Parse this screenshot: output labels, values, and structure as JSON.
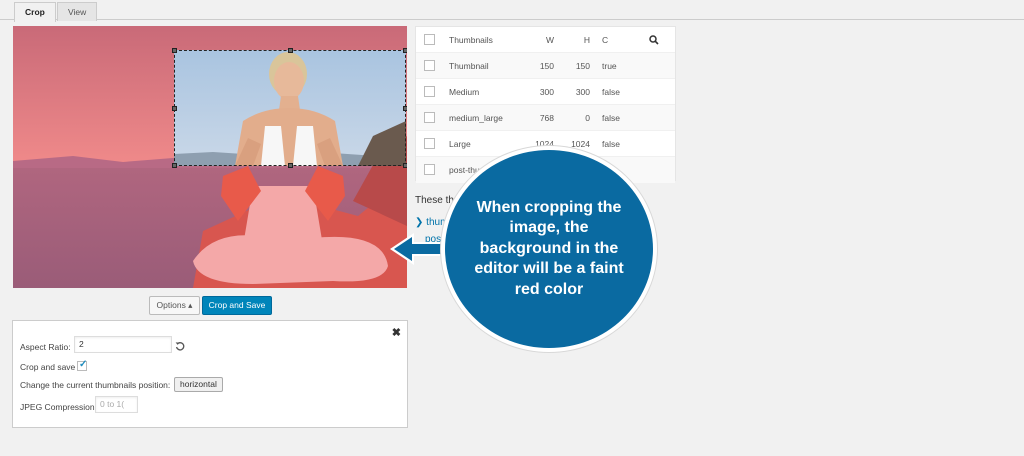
{
  "tabs": [
    {
      "label": "Crop",
      "active": true
    },
    {
      "label": "View",
      "active": false
    }
  ],
  "toolbar": {
    "options_label": "Options ▴",
    "crop_save_label": "Crop and Save"
  },
  "options_panel": {
    "close_icon": "✖",
    "aspect_ratio_label": "Aspect Ratio:",
    "aspect_ratio_value": "2",
    "crop_and_save_label": "Crop and save",
    "crop_and_save_checked": true,
    "thumbs_position_label": "Change the current thumbnails position:",
    "thumbs_position_value": "horizontal",
    "jpeg_label": "JPEG Compression",
    "jpeg_placeholder": "0 to 1("
  },
  "thumbnails": {
    "headers": {
      "name": "Thumbnails",
      "w": "W",
      "h": "H",
      "c": "C"
    },
    "rows": [
      {
        "name": "Thumbnail",
        "w": "150",
        "h": "150",
        "c": "true"
      },
      {
        "name": "Medium",
        "w": "300",
        "h": "300",
        "c": "false"
      },
      {
        "name": "medium_large",
        "w": "768",
        "h": "0",
        "c": "false"
      },
      {
        "name": "Large",
        "w": "1024",
        "h": "1024",
        "c": "false"
      },
      {
        "name": "post-thum",
        "w": "",
        "h": "",
        "c": ""
      }
    ]
  },
  "side": {
    "caption": "These th",
    "links": [
      "thum",
      "post"
    ]
  },
  "callout": {
    "text": "When cropping the image, the background in the editor will be a faint red color"
  },
  "colors": {
    "accent": "#0085ba",
    "callout": "#0a6aa1",
    "crop_overlay": "#e8696f"
  }
}
